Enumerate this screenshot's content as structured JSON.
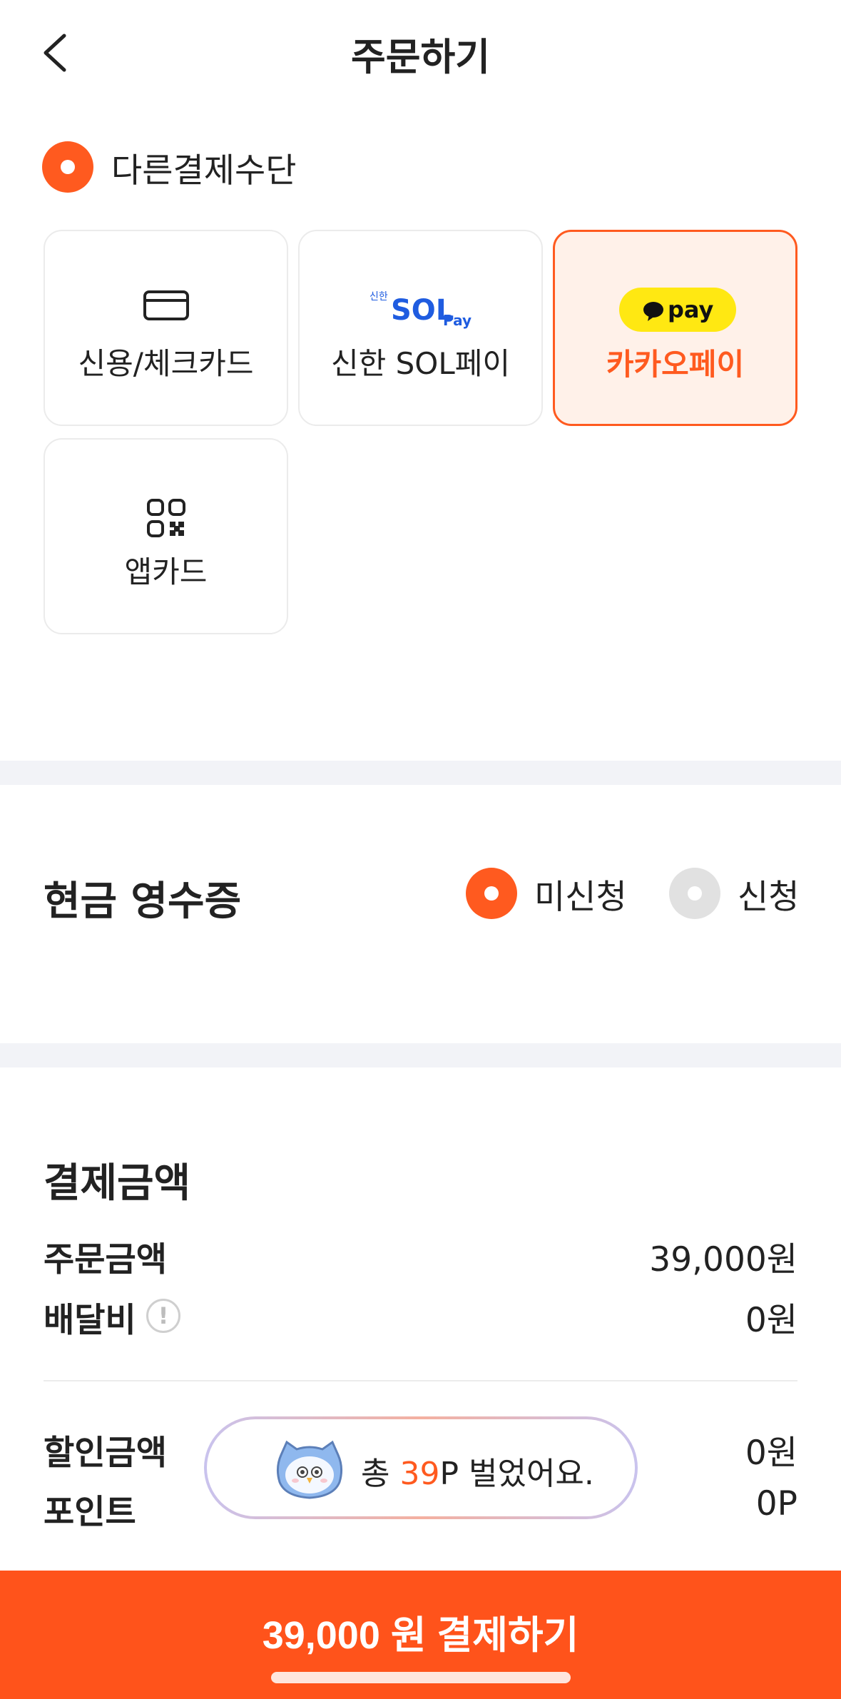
{
  "header": {
    "title": "주문하기"
  },
  "payment_method": {
    "option_label": "다른결제수단",
    "cards": [
      {
        "label": "신용/체크카드",
        "icon": "credit-card-icon",
        "selected": false
      },
      {
        "label": "신한 SOL페이",
        "icon": "shinhan-sol-pay-logo",
        "logo_small": "신한",
        "logo_main": "SOL",
        "logo_sub": "Pay",
        "selected": false
      },
      {
        "label": "카카오페이",
        "icon": "kakaopay-logo",
        "logo_text": "pay",
        "selected": true
      },
      {
        "label": "앱카드",
        "icon": "app-card-icon",
        "selected": false
      }
    ]
  },
  "cash_receipt": {
    "title": "현금 영수증",
    "options": [
      {
        "label": "미신청",
        "selected": true
      },
      {
        "label": "신청",
        "selected": false
      }
    ]
  },
  "payment_amount": {
    "title": "결제금액",
    "order_amount_label": "주문금액",
    "order_amount_value": "39,000원",
    "delivery_fee_label": "배달비",
    "delivery_fee_value": "0원",
    "discount_label": "할인금액",
    "discount_value": "0원",
    "point_label": "포인트",
    "point_value": "0P"
  },
  "toast": {
    "prefix": "총 ",
    "points": "39",
    "suffix": "P 벌었어요."
  },
  "cta": {
    "label": "39,000 원 결제하기"
  },
  "colors": {
    "accent": "#ff5a1f",
    "selected_bg": "#fff1e9",
    "kakao_yellow": "#ffe812",
    "shinhan_blue": "#1f5ce0"
  }
}
